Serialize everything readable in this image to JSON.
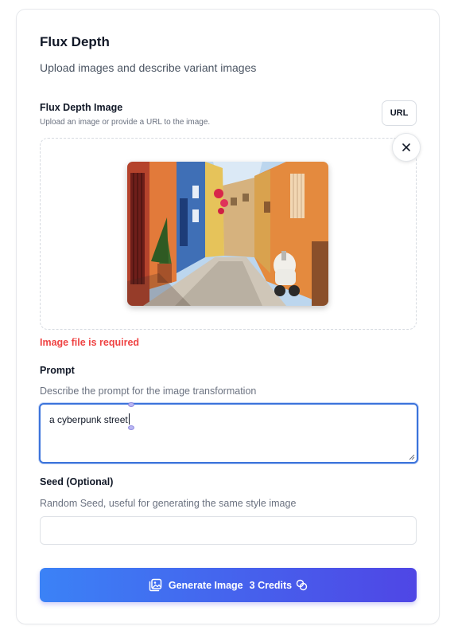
{
  "header": {
    "title": "Flux Depth",
    "subtitle": "Upload images and describe variant images"
  },
  "image_field": {
    "label": "Flux Depth Image",
    "hint": "Upload an image or provide a URL to the image.",
    "url_button": "URL",
    "error": "Image file is required"
  },
  "prompt_field": {
    "label": "Prompt",
    "description": "Describe the prompt for the image transformation",
    "value": "a cyberpunk street"
  },
  "seed_field": {
    "label": "Seed (Optional)",
    "description": "Random Seed, useful for generating the same style image",
    "value": ""
  },
  "generate_button": {
    "label": "Generate Image",
    "credits": "3 Credits"
  },
  "colors": {
    "accent_start": "#3b82f6",
    "accent_end": "#4f46e5",
    "error": "#ef4444",
    "focus_border": "#3b73db"
  },
  "icons": {
    "close": "close-icon",
    "generate": "image-gallery-icon",
    "credits": "coins-icon"
  }
}
